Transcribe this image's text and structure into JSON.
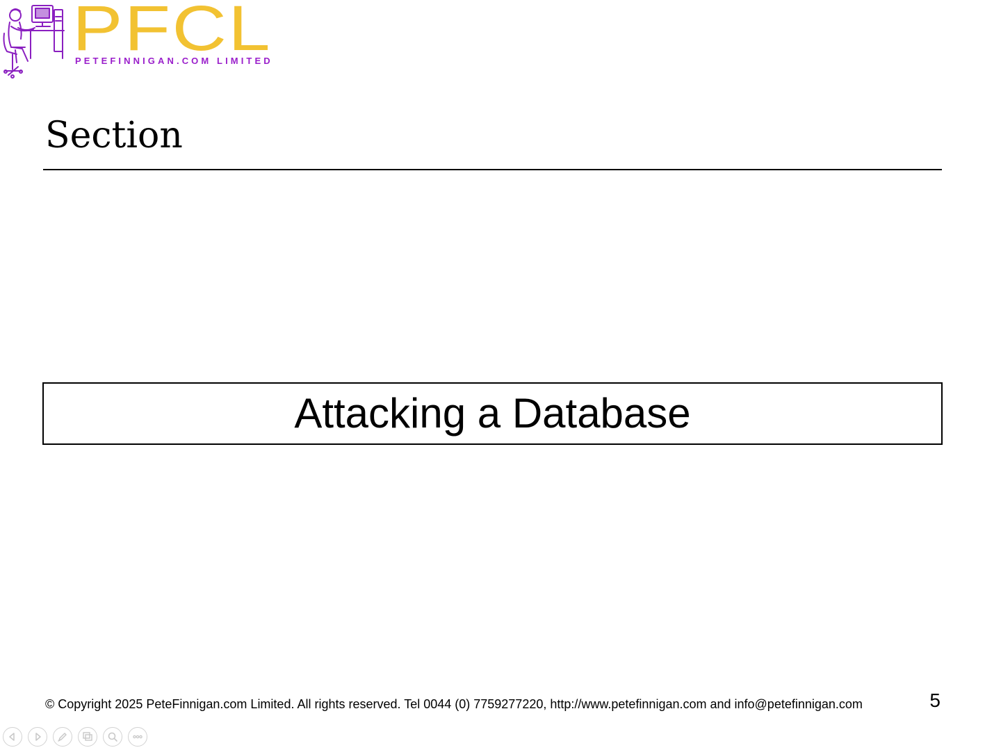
{
  "logo": {
    "mark": "PFCL",
    "subtitle": "PETEFINNIGAN.COM LIMITED",
    "mark_color": "#f2c232",
    "subtitle_color": "#9a1fcb",
    "art_color": "#8a1fc0"
  },
  "slide": {
    "section_title": "Section",
    "heading": "Attacking a Database",
    "footer": "© Copyright 2025 PeteFinnigan.com Limited. All rights reserved. Tel 0044 (0) 7759277220, http://www.petefinnigan.com and info@petefinnigan.com",
    "page_number": "5"
  },
  "toolbar": {
    "buttons": [
      {
        "name": "previous-slide-button",
        "icon": "triangle-left-icon"
      },
      {
        "name": "next-slide-button",
        "icon": "triangle-right-icon"
      },
      {
        "name": "pen-button",
        "icon": "pen-icon"
      },
      {
        "name": "slides-overview-button",
        "icon": "slides-grid-icon"
      },
      {
        "name": "zoom-button",
        "icon": "magnifier-icon"
      },
      {
        "name": "more-options-button",
        "icon": "ellipsis-icon"
      }
    ],
    "icon_color": "#c8c8c8"
  }
}
